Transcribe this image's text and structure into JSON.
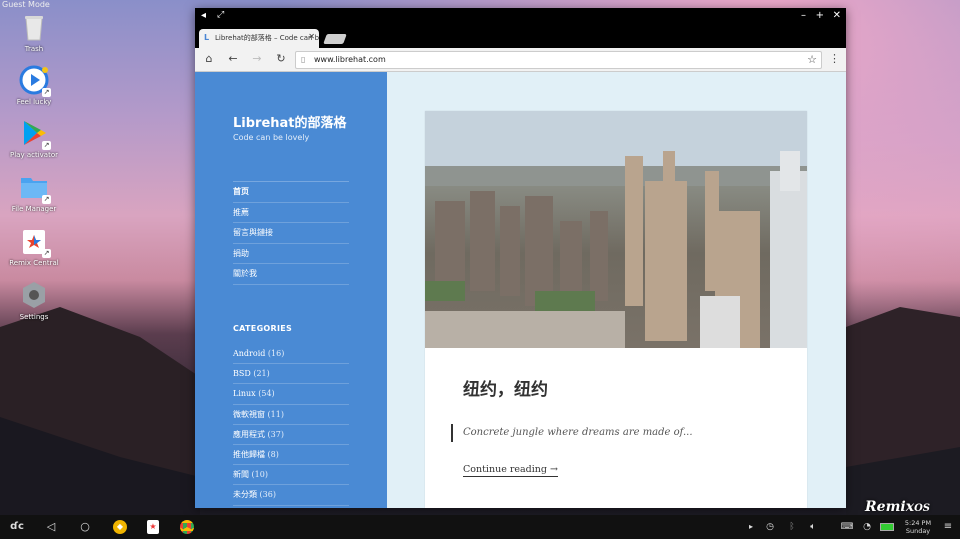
{
  "os": {
    "mode_label": "Guest Mode",
    "watermark": "Remix OS",
    "desktop_icons": [
      {
        "label": "Trash",
        "icon": "trash-icon"
      },
      {
        "label": "Feel lucky",
        "icon": "play-lucky-icon"
      },
      {
        "label": "Play activator",
        "icon": "play-store-icon"
      },
      {
        "label": "File Manager",
        "icon": "folder-icon"
      },
      {
        "label": "Remix Central",
        "icon": "remix-central-icon"
      },
      {
        "label": "Settings",
        "icon": "settings-icon"
      }
    ],
    "clock": {
      "time": "5:24 PM",
      "day": "Sunday"
    }
  },
  "browser": {
    "tab_title": "Librehat的部落格 – Code can be lovely",
    "url": "www.librehat.com"
  },
  "site": {
    "title": "Librehat的部落格",
    "description": "Code can be lovely",
    "nav": [
      "首页",
      "推薦",
      "留言與鏈接",
      "捐助",
      "關於我"
    ],
    "categories_heading": "CATEGORIES",
    "categories": [
      {
        "name": "Android",
        "count": "(16)"
      },
      {
        "name": "BSD",
        "count": "(21)"
      },
      {
        "name": "Linux",
        "count": "(54)"
      },
      {
        "name": "微軟視窗",
        "count": "(11)"
      },
      {
        "name": "應用程式",
        "count": "(37)"
      },
      {
        "name": "推他歸檔",
        "count": "(8)"
      },
      {
        "name": "新聞",
        "count": "(10)"
      },
      {
        "name": "未分類",
        "count": "(36)"
      }
    ]
  },
  "post": {
    "title": "纽约，纽约",
    "excerpt": "Concrete jungle where dreams are made of...",
    "continue_label": "Continue reading →"
  },
  "colors": {
    "sidebar": "#4a8ad4",
    "page_bg": "#e1f0f7"
  }
}
